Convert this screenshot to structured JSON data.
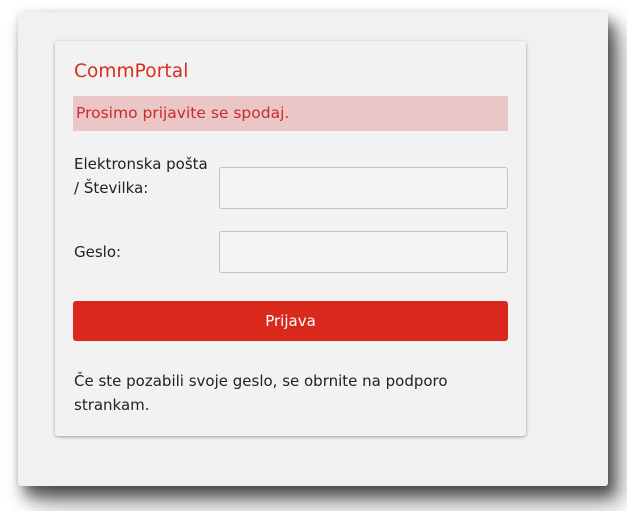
{
  "app": {
    "title": "CommPortal"
  },
  "alert": {
    "message": "Prosimo prijavite se spodaj."
  },
  "form": {
    "email_label": "Elektronska pošta / Številka:",
    "email_value": "",
    "password_label": "Geslo:",
    "password_value": "",
    "submit_label": "Prijava"
  },
  "footer": {
    "help_text": "Če ste pozabili svoje geslo, se obrnite na podporo strankam."
  },
  "colors": {
    "brand_red": "#d9281c",
    "alert_background": "#ebc6c6",
    "alert_text": "#cc2a2a",
    "card_background": "#f2f2f2"
  }
}
